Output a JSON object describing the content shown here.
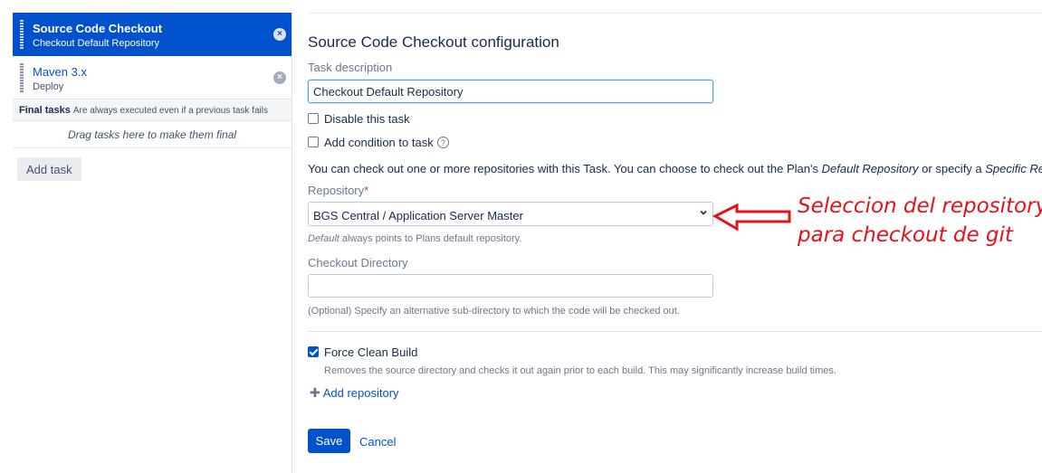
{
  "tasks": [
    {
      "name": "Source Code Checkout",
      "description": "Checkout Default Repository",
      "selected": true
    },
    {
      "name": "Maven 3.x",
      "description": "Deploy",
      "selected": false
    }
  ],
  "final_tasks": {
    "title": "Final tasks",
    "subtitle": "Are always executed even if a previous task fails",
    "drop_hint": "Drag tasks here to make them final"
  },
  "add_task_label": "Add task",
  "form": {
    "title": "Source Code Checkout configuration",
    "task_description_label": "Task description",
    "task_description_value": "Checkout Default Repository",
    "disable_label": "Disable this task",
    "disable_checked": false,
    "condition_label": "Add condition to task",
    "info_prefix": "You can check out one or more repositories with this Task. You can choose to check out the Plan's ",
    "info_default": "Default Repository",
    "info_middle": " or specify a ",
    "info_specific": "Specific Rep",
    "repository_label": "Repository",
    "repository_required_mark": "*",
    "repository_value": "BGS Central / Application Server Master",
    "repository_hint_em": "Default",
    "repository_hint_rest": " always points to Plans default repository.",
    "checkout_dir_label": "Checkout Directory",
    "checkout_dir_value": "",
    "checkout_dir_hint": "(Optional) Specify an alternative sub-directory to which the code will be checked out.",
    "force_clean_label": "Force Clean Build",
    "force_clean_checked": true,
    "force_clean_hint": "Removes the source directory and checks it out again prior to each build. This may significantly increase build times.",
    "add_repository_label": "Add repository",
    "save_label": "Save",
    "cancel_label": "Cancel"
  },
  "annotation": {
    "line1": "Seleccion del repository",
    "line2": "para checkout de git",
    "color": "#e3121b"
  },
  "colors": {
    "accent": "#0052cc",
    "annotation": "#e3121b"
  }
}
